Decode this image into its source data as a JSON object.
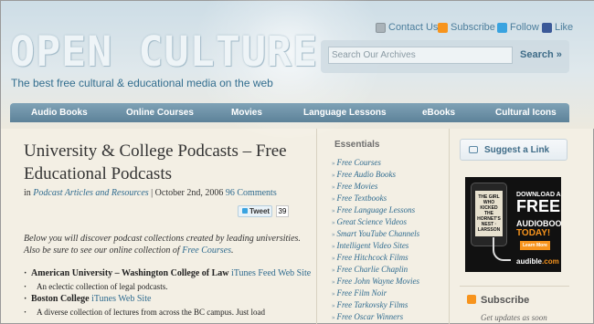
{
  "site": {
    "logo": "OPEN CULTURE",
    "tagline": "The best free cultural & educational media on the web"
  },
  "social": [
    {
      "label": "Contact Us",
      "icon": "mail-icon",
      "color": "#9aa4ab"
    },
    {
      "label": "Subscribe",
      "icon": "rss-icon",
      "color": "#f7941d"
    },
    {
      "label": "Follow",
      "icon": "twitter-icon",
      "color": "#39a3e0"
    },
    {
      "label": "Like",
      "icon": "facebook-icon",
      "color": "#3b5998"
    }
  ],
  "search": {
    "placeholder": "Search Our Archives",
    "button": "Search »"
  },
  "nav": [
    "Audio Books",
    "Online Courses",
    "Movies",
    "Language Lessons",
    "eBooks",
    "Cultural Icons"
  ],
  "article": {
    "title": "University & College Podcasts – Free Educational Podcasts",
    "meta_in": "in",
    "category": "Podcast Articles and Resources",
    "date": "| October 2nd, 2006",
    "comments": "96 Comments",
    "tweet_label": "Tweet",
    "tweet_count": "39",
    "intro_text": "Below you will discover podcast collections created by leading universities. Also be sure to see our online collection of ",
    "intro_link": "Free Courses",
    "intro_end": ".",
    "items": [
      {
        "name": "American University – Washington College of Law",
        "link": "iTunes Feed Web Site",
        "desc": "An eclectic collection of legal podcasts."
      },
      {
        "name": "Boston College",
        "link": "iTunes Web Site",
        "desc": "A diverse collection of lectures from across the BC campus. Just load"
      }
    ]
  },
  "essentials": {
    "title": "Essentials",
    "items": [
      "Free Courses",
      "Free Audio Books",
      "Free Movies",
      "Free Textbooks",
      "Free Language Lessons",
      "Great Science Videos",
      "Smart YouTube Channels",
      "Intelligent Video Sites",
      "Free Hitchcock Films",
      "Free Charlie Chaplin",
      "Free John Wayne Movies",
      "Free Film Noir",
      "Free Tarkovsky Films",
      "Free Oscar Winners"
    ]
  },
  "sidebar": {
    "suggest": "Suggest a Link",
    "ad": {
      "line1": "DOWNLOAD A",
      "line2": "FREE",
      "line3": "AUDIOBOOK",
      "line4": "TODAY!",
      "button": "Learn More",
      "brand_prefix": "audible",
      "brand_suffix": ".com",
      "book": "THE GIRL WHO KICKED THE HORNET'S NEST · LARSSON"
    },
    "subscribe_title": "Subscribe",
    "subscribe_text": "Get updates as soon"
  }
}
